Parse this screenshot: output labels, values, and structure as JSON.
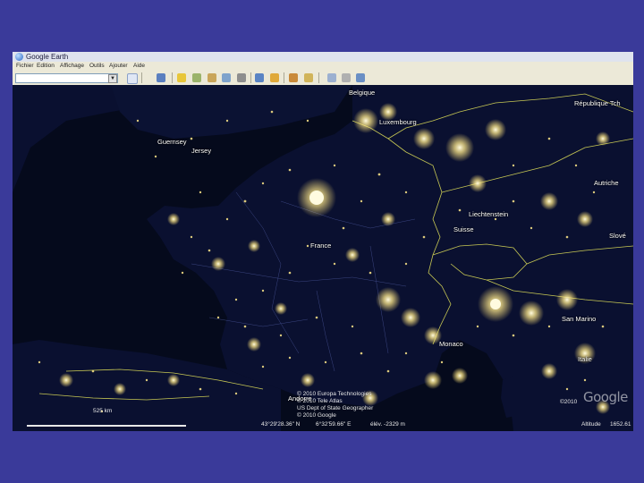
{
  "window": {
    "title": "Google Earth",
    "menus": [
      "Fichier",
      "Edition",
      "Affichage",
      "Outils",
      "Ajouter",
      "Aide"
    ]
  },
  "map": {
    "labels": {
      "guernsey": "Guernsey",
      "jersey": "Jersey",
      "belgique": "Belgique",
      "luxembourg": "Luxembourg",
      "republique_tcheque": "République Tch",
      "autriche": "Autriche",
      "liechtenstein": "Liechtenstein",
      "suisse": "Suisse",
      "slovenie": "Slové",
      "france": "France",
      "san_marino": "San Marino",
      "monaco": "Monaco",
      "italie": "Italie",
      "andorre": "Andorre"
    },
    "credits": [
      "© 2010 Europa Technologies",
      "© 2010 Tele Atlas",
      "US Dept of State Geographer",
      "© 2010 Google"
    ],
    "logo": "Google",
    "copyright_year": "©2010"
  },
  "status": {
    "scale": "525 km",
    "latitude": "43°29'28.36\" N",
    "longitude": "6°32'59.66\" E",
    "elevation": "élév. -2329 m",
    "altitude": "Altitude",
    "altitude_value": "1652.61"
  },
  "colors": {
    "background": "#3a3a9a",
    "city_lights": "#fff2a8",
    "borders": "#e8e85a"
  }
}
